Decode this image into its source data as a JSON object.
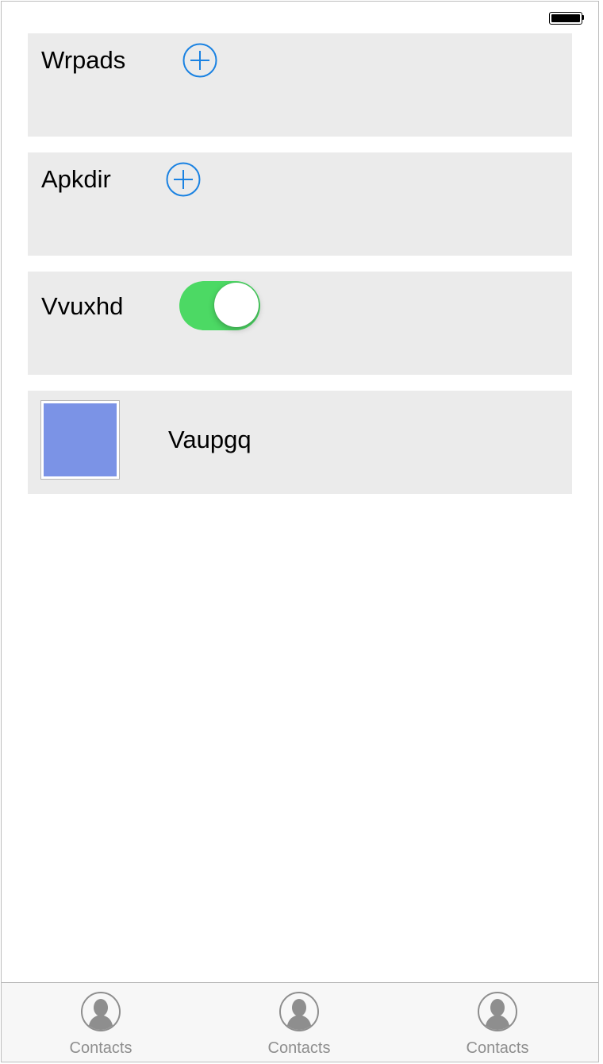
{
  "status_bar": {
    "battery_icon": "battery-full-icon",
    "battery_level": 1.0
  },
  "rows": {
    "row1": {
      "label": "Wrpads",
      "icon": "add-circle-icon"
    },
    "row2": {
      "label": "Apkdir",
      "icon": "add-circle-icon"
    },
    "row3": {
      "label": "Vvuxhd",
      "toggle_on": true,
      "toggle_color": "#4cd964"
    },
    "row4": {
      "label": "Vaupgq",
      "swatch_color": "#7b93e6"
    }
  },
  "colors": {
    "accent": "#1a82e2",
    "row_background": "#ebebeb",
    "tab_icon": "#8e8e8e"
  },
  "tab_bar": {
    "tabs": [
      {
        "label": "Contacts",
        "icon": "contact-person-icon"
      },
      {
        "label": "Contacts",
        "icon": "contact-person-icon"
      },
      {
        "label": "Contacts",
        "icon": "contact-person-icon"
      }
    ]
  }
}
